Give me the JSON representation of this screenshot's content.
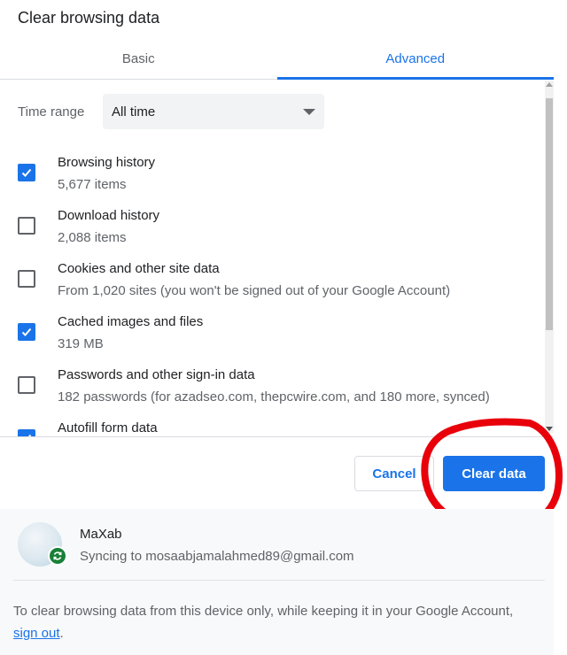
{
  "dialog": {
    "title": "Clear browsing data"
  },
  "tabs": [
    {
      "label": "Basic",
      "active": false
    },
    {
      "label": "Advanced",
      "active": true
    }
  ],
  "time_range": {
    "label": "Time range",
    "value": "All time"
  },
  "options": [
    {
      "label": "Browsing history",
      "description": "5,677 items",
      "checked": true
    },
    {
      "label": "Download history",
      "description": "2,088 items",
      "checked": false
    },
    {
      "label": "Cookies and other site data",
      "description": "From 1,020 sites (you won't be signed out of your Google Account)",
      "checked": false
    },
    {
      "label": "Cached images and files",
      "description": "319 MB",
      "checked": true
    },
    {
      "label": "Passwords and other sign-in data",
      "description": "182 passwords (for azadseo.com, thepcwire.com, and 180 more, synced)",
      "checked": false
    },
    {
      "label": "Autofill form data",
      "description": "",
      "checked": true
    }
  ],
  "buttons": {
    "cancel": "Cancel",
    "clear": "Clear data"
  },
  "account": {
    "name": "MaXab",
    "sync_status": "Syncing to mosaabjamalahmed89@gmail.com"
  },
  "footer": {
    "text_before": "To clear browsing data from this device only, while keeping it in your Google Account, ",
    "link": "sign out",
    "text_after": "."
  },
  "colors": {
    "accent": "#1a73e8",
    "sync_badge": "#188038",
    "annotation": "#e8000b"
  }
}
